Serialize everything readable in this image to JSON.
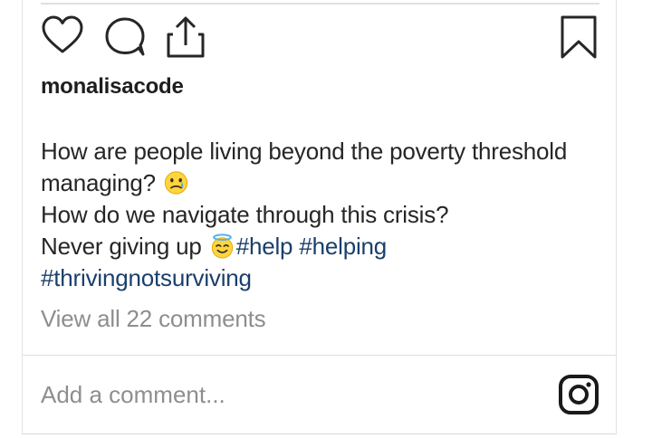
{
  "post": {
    "username": "monalisacode",
    "caption": {
      "line1": "How are people living beyond the poverty threshold",
      "line2": "managing?",
      "line3": "How do we navigate through this crisis?",
      "line4_text": "Never giving up",
      "hashtag1": "#help",
      "hashtag2": "#helping",
      "hashtag3": "#thrivingnotsurviving"
    },
    "emojis": [
      "crying-smiley-emoji",
      "halo-smiley-emoji"
    ],
    "view_comments": "View all 22 comments",
    "comment_placeholder": "Add a comment..."
  },
  "icons": {
    "like": "heart-outline-icon",
    "comment": "comment-bubble-icon",
    "share": "share-upload-icon",
    "bookmark": "bookmark-outline-icon",
    "instagram": "instagram-logo-icon"
  },
  "colors": {
    "text": "#262626",
    "muted": "#8e8e8e",
    "hashtag": "#1a3f6b"
  }
}
